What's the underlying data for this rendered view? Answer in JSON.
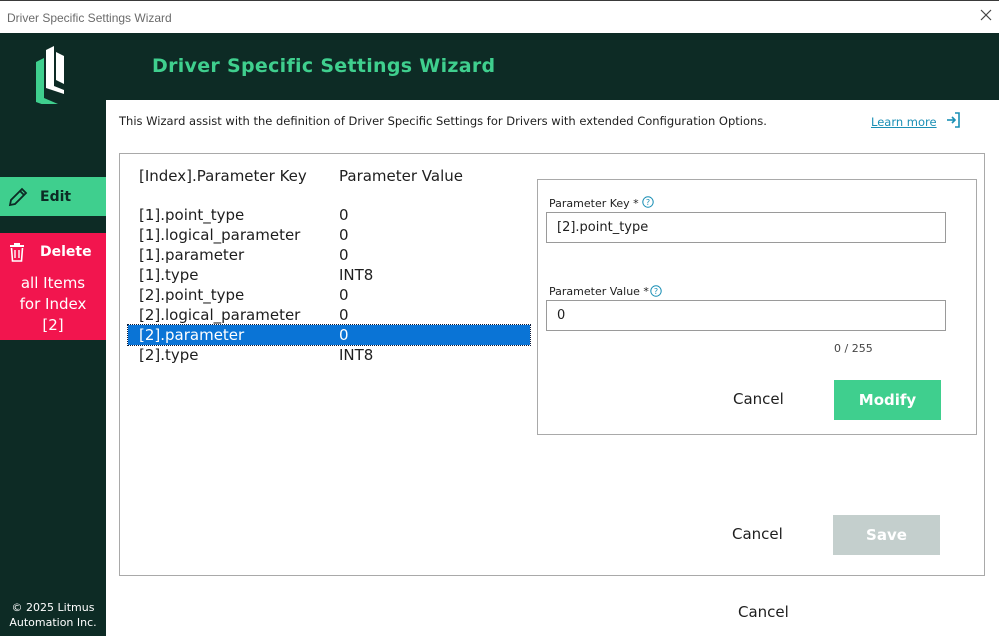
{
  "window": {
    "title": "Driver Specific Settings Wizard"
  },
  "sidebar": {
    "edit_label": "Edit",
    "delete_label": "Delete",
    "delete_sub": "all Items\nfor Index\n[2]",
    "copyright": "© 2025 Litmus\nAutomation Inc."
  },
  "header": {
    "title": "Driver Specific Settings Wizard"
  },
  "intro": {
    "description": "This Wizard assist with the definition of Driver Specific Settings for Drivers with extended Configuration Options.",
    "learn_more": "Learn more"
  },
  "table": {
    "col_key": "[Index].Parameter Key",
    "col_value": "Parameter Value",
    "rows": [
      {
        "key": "[1].point_type",
        "value": "0"
      },
      {
        "key": "[1].logical_parameter",
        "value": "0"
      },
      {
        "key": "[1].parameter",
        "value": "0"
      },
      {
        "key": "[1].type",
        "value": "INT8"
      },
      {
        "key": "[2].point_type",
        "value": "0"
      },
      {
        "key": "[2].logical_parameter",
        "value": "0"
      },
      {
        "key": "[2].parameter",
        "value": "0"
      },
      {
        "key": "[2].type",
        "value": "INT8"
      }
    ],
    "selected_index": 6
  },
  "editor": {
    "key_label": "Parameter Key *",
    "key_value": "[2].point_type",
    "value_label": "Parameter Value *",
    "value_value": "0",
    "counter": "0 / 255",
    "cancel": "Cancel",
    "modify": "Modify"
  },
  "footer": {
    "cancel": "Cancel",
    "save": "Save",
    "outer_cancel": "Cancel"
  },
  "colors": {
    "dark": "#0d2b25",
    "accent": "#3fcf8e",
    "danger": "#f2154e",
    "selection": "#0a74d6",
    "link": "#1a8fb5"
  }
}
